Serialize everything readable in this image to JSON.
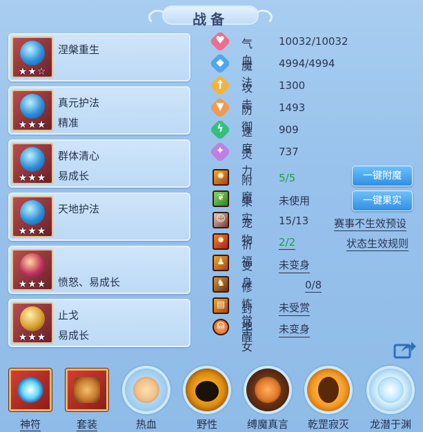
{
  "header": {
    "title": "战备"
  },
  "slots": [
    {
      "name": "涅槃重生",
      "trait": "",
      "stars": "★★☆"
    },
    {
      "name": "真元护法",
      "trait": "精准",
      "stars": "★★★"
    },
    {
      "name": "群体清心",
      "trait": "易成长",
      "stars": "★★★"
    },
    {
      "name": "天地护法",
      "trait": "",
      "stars": "★★★"
    },
    {
      "name": "",
      "trait": "愤怒、易成长",
      "stars": "★★★"
    },
    {
      "name": "止戈",
      "trait": "易成长",
      "stars": "★★★"
    }
  ],
  "stats": [
    {
      "label": "气血",
      "value": "10032/10032",
      "icon": "heart-icon",
      "color": "#ee6f8c",
      "glyph": "♥"
    },
    {
      "label": "魔法",
      "value": "4994/4994",
      "icon": "magic-icon",
      "color": "#4fa6ef",
      "glyph": "◆"
    },
    {
      "label": "攻击",
      "value": "1300",
      "icon": "sword-icon",
      "color": "#f2b441",
      "glyph": "†"
    },
    {
      "label": "防御",
      "value": "1493",
      "icon": "shield-icon",
      "color": "#f09a4d",
      "glyph": "▼"
    },
    {
      "label": "速度",
      "value": "909",
      "icon": "lightning-icon",
      "color": "#35c07a",
      "glyph": "ϟ"
    },
    {
      "label": "灵力",
      "value": "737",
      "icon": "spirit-icon",
      "color": "#c07fe6",
      "glyph": "✦"
    }
  ],
  "extras": [
    {
      "label": "附魔",
      "value": "5/5",
      "green": true,
      "underline": false,
      "glyph": "✺",
      "icon": "enchant-icon"
    },
    {
      "label": "果实",
      "value": "未使用",
      "green": false,
      "underline": false,
      "glyph": "❦",
      "icon": "fruit-icon"
    },
    {
      "label": "宠物",
      "value": "15/13",
      "green": false,
      "underline": false,
      "glyph": "☺",
      "icon": "pet-icon"
    },
    {
      "label": "祈福",
      "value": "2/2",
      "green": true,
      "underline": true,
      "glyph": "✹",
      "icon": "blessing-icon"
    },
    {
      "label": "变身",
      "value": "未变身",
      "green": false,
      "underline": true,
      "glyph": "♟",
      "icon": "transform-icon"
    },
    {
      "label": "修炼觉醒",
      "value": "0/8",
      "green": false,
      "underline": true,
      "glyph": "♞",
      "icon": "cultivation-icon"
    },
    {
      "label": "封地",
      "value": "未受赏",
      "green": false,
      "underline": true,
      "glyph": "▤",
      "icon": "fief-icon"
    },
    {
      "label": "子女",
      "value": "未变身",
      "green": false,
      "underline": true,
      "glyph": "☊",
      "icon": "children-icon"
    }
  ],
  "buttons": {
    "enchant": "一键附魔",
    "fruit": "一键果实"
  },
  "links": {
    "preset": "赛事不生效预设",
    "rules": "状态生效规则"
  },
  "tabs": [
    {
      "label": "神符",
      "shape": "square",
      "color": "#5fd8ff",
      "underline": true
    },
    {
      "label": "套装",
      "shape": "square",
      "color": "#c77a2e",
      "underline": true
    },
    {
      "label": "热血",
      "shape": "round",
      "color": "#f0c08a",
      "underline": false
    },
    {
      "label": "野性",
      "shape": "round",
      "color": "#ffb020",
      "underline": false
    },
    {
      "label": "缚魔真言",
      "shape": "round",
      "color": "#e07a2a",
      "underline": false
    },
    {
      "label": "乾罡寂灭",
      "shape": "round",
      "color": "#f59a20",
      "underline": false
    },
    {
      "label": "龙潜于渊",
      "shape": "round",
      "color": "#d8f2ff",
      "underline": false
    }
  ]
}
